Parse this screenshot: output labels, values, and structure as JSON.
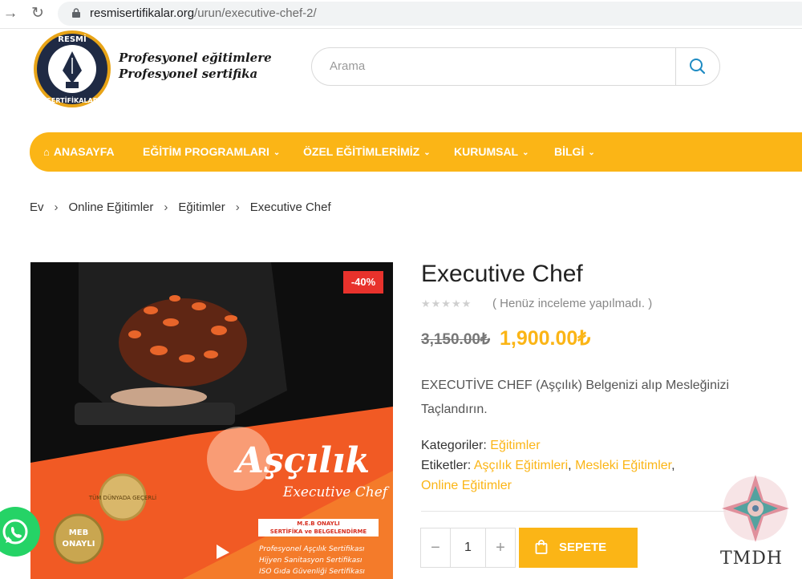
{
  "browser": {
    "url_domain": "resmisertifikalar.org",
    "url_path": "/urun/executive-chef-2/"
  },
  "header": {
    "logo_top_text": "RESMİ",
    "logo_bottom_text": "SERTİFİKALAR",
    "tagline_line1": "Profesyonel eğitimlere",
    "tagline_line2": "Profesyonel sertifika",
    "search_placeholder": "Arama"
  },
  "nav": {
    "items": [
      {
        "label": "ANASAYFA",
        "icon": "home-icon"
      },
      {
        "label": "EĞİTİM PROGRAMLARI",
        "has_dropdown": true
      },
      {
        "label": "ÖZEL EĞİTİMLERİMİZ",
        "has_dropdown": true
      },
      {
        "label": "KURUMSAL",
        "has_dropdown": true
      },
      {
        "label": "BİLGİ",
        "has_dropdown": true
      }
    ]
  },
  "breadcrumb": [
    "Ev",
    "Online Eğitimler",
    "Eğitimler",
    "Executive Chef"
  ],
  "product": {
    "title": "Executive Chef",
    "rating": 0,
    "review_text": "( Henüz inceleme yapılmadı. )",
    "old_price": "3,150.00₺",
    "new_price": "1,900.00₺",
    "sale_badge": "-40%",
    "description": "EXECUTİVE CHEF (Aşçılık) Belgenizi alıp Mesleğinizi Taçlandırın.",
    "categories_label": "Kategoriler:",
    "categories": [
      "Eğitimler"
    ],
    "tags_label": "Etiketler:",
    "tags": [
      "Aşçılık Eğitimleri",
      "Mesleki Eğitimler",
      "Online Eğitimler"
    ],
    "quantity": "1",
    "add_to_cart": "SEPETE EKLE"
  },
  "product_image": {
    "title": "Aşçılık",
    "subtitle": "Executive Chef",
    "seal1": "TÜM DÜNYADA GEÇERLİ",
    "seal2_top": "MEB",
    "seal2_bottom": "ONAYLI",
    "meb_line1": "M.E.B ONAYLI",
    "meb_line2": "SERTİFİKA ve BELGELENDİRME",
    "list": [
      "Profesyonel Aşçılık Sertifikası",
      "Hijyen Sanitasyon Sertifikası",
      "ISO Gıda Güvenliği Sertifikası"
    ]
  },
  "watermark_text": "TMDH",
  "colors": {
    "accent": "#fbb516",
    "sale": "#e8322c",
    "whatsapp": "#25d366",
    "orange": "#f15a24"
  }
}
